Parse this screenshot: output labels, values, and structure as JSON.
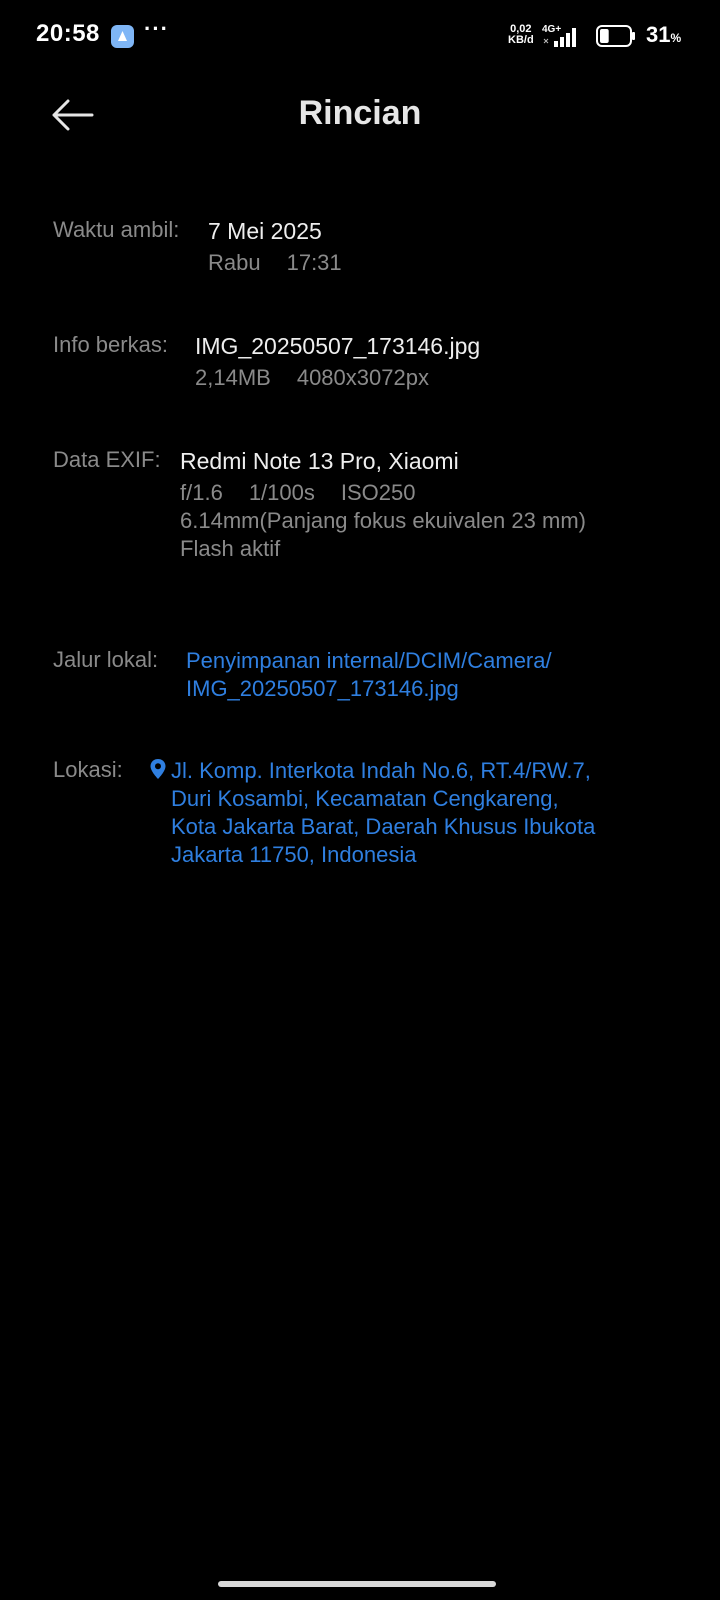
{
  "status_bar": {
    "time": "20:58",
    "more": "···",
    "speed_value": "0,02",
    "speed_unit": "KB/d",
    "network": "4G+",
    "battery_value": "31",
    "battery_unit": "%",
    "battery_level": 0.31
  },
  "header": {
    "title": "Rincian",
    "back_icon": "arrow-left-icon"
  },
  "details": {
    "taken": {
      "label": "Waktu ambil:",
      "date": "7 Mei 2025",
      "day": "Rabu",
      "time": "17:31"
    },
    "file": {
      "label": "Info berkas:",
      "name": "IMG_20250507_173146.jpg",
      "size": "2,14MB",
      "resolution": "4080x3072px"
    },
    "exif": {
      "label": "Data EXIF:",
      "device": "Redmi Note 13 Pro, Xiaomi",
      "aperture": "f/1.6",
      "shutter": "1/100s",
      "iso": "ISO250",
      "focal": "6.14mm(Panjang fokus ekuivalen 23 mm)",
      "flash": "Flash aktif"
    },
    "path": {
      "label": "Jalur lokal:",
      "line1": "Penyimpanan internal/DCIM/Camera/",
      "line2": "IMG_20250507_173146.jpg"
    },
    "location": {
      "label": "Lokasi:",
      "icon": "location-pin-icon",
      "line1": "Jl. Komp. Interkota Indah No.6, RT.4/RW.7,",
      "line2": "Duri Kosambi, Kecamatan Cengkareng,",
      "line3": "Kota Jakarta Barat, Daerah Khusus Ibukota",
      "line4": "Jakarta 11750, Indonesia"
    }
  },
  "colors": {
    "background": "#000000",
    "label": "#8a8a8a",
    "value": "#eeeeee",
    "link": "#2f7fe0"
  }
}
